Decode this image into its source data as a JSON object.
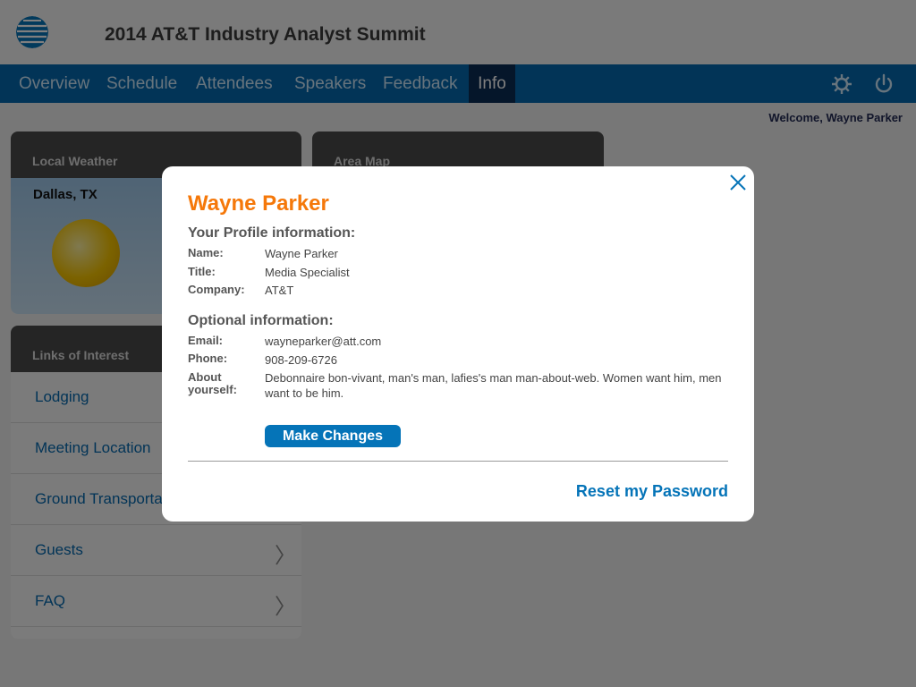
{
  "app": {
    "title": "2014 AT&T Industry Analyst Summit"
  },
  "nav": {
    "tabs": [
      {
        "label": "Overview"
      },
      {
        "label": "Schedule"
      },
      {
        "label": "Attendees"
      },
      {
        "label": "Speakers"
      },
      {
        "label": "Feedback"
      },
      {
        "label": "Info",
        "active": true
      }
    ],
    "icons": [
      "gear-icon",
      "power-icon"
    ]
  },
  "welcome": "Welcome, Wayne Parker",
  "weather": {
    "header": "Local Weather",
    "city": "Dallas, TX"
  },
  "map": {
    "header": "Area Map"
  },
  "links": {
    "header": "Links of Interest",
    "items": [
      {
        "label": "Lodging"
      },
      {
        "label": "Meeting Location"
      },
      {
        "label": "Ground Transportation"
      },
      {
        "label": "Guests"
      },
      {
        "label": "FAQ"
      }
    ]
  },
  "profile": {
    "name": "Wayne Parker",
    "profile_section": "Your Profile information:",
    "name_label": "Name:",
    "name_value": "Wayne Parker",
    "title_label": "Title:",
    "title_value": "Media Specialist",
    "company_label": "Company:",
    "company_value": "AT&T",
    "optional_section": "Optional information:",
    "email_label": "Email:",
    "email_value": "wayneparker@att.com",
    "phone_label": "Phone:",
    "phone_value": "908-209-6726",
    "about_label": "About yourself:",
    "about_value": "Debonnaire bon-vivant, man's man, lafies's man man-about-web. Women want him, men want to be him.",
    "make_changes": "Make Changes",
    "reset_password": "Reset my Password"
  },
  "colors": {
    "nav_bg": "#0568ae",
    "nav_active": "#0b2c55",
    "accent": "#0574b8",
    "name_orange": "#f5780a"
  }
}
